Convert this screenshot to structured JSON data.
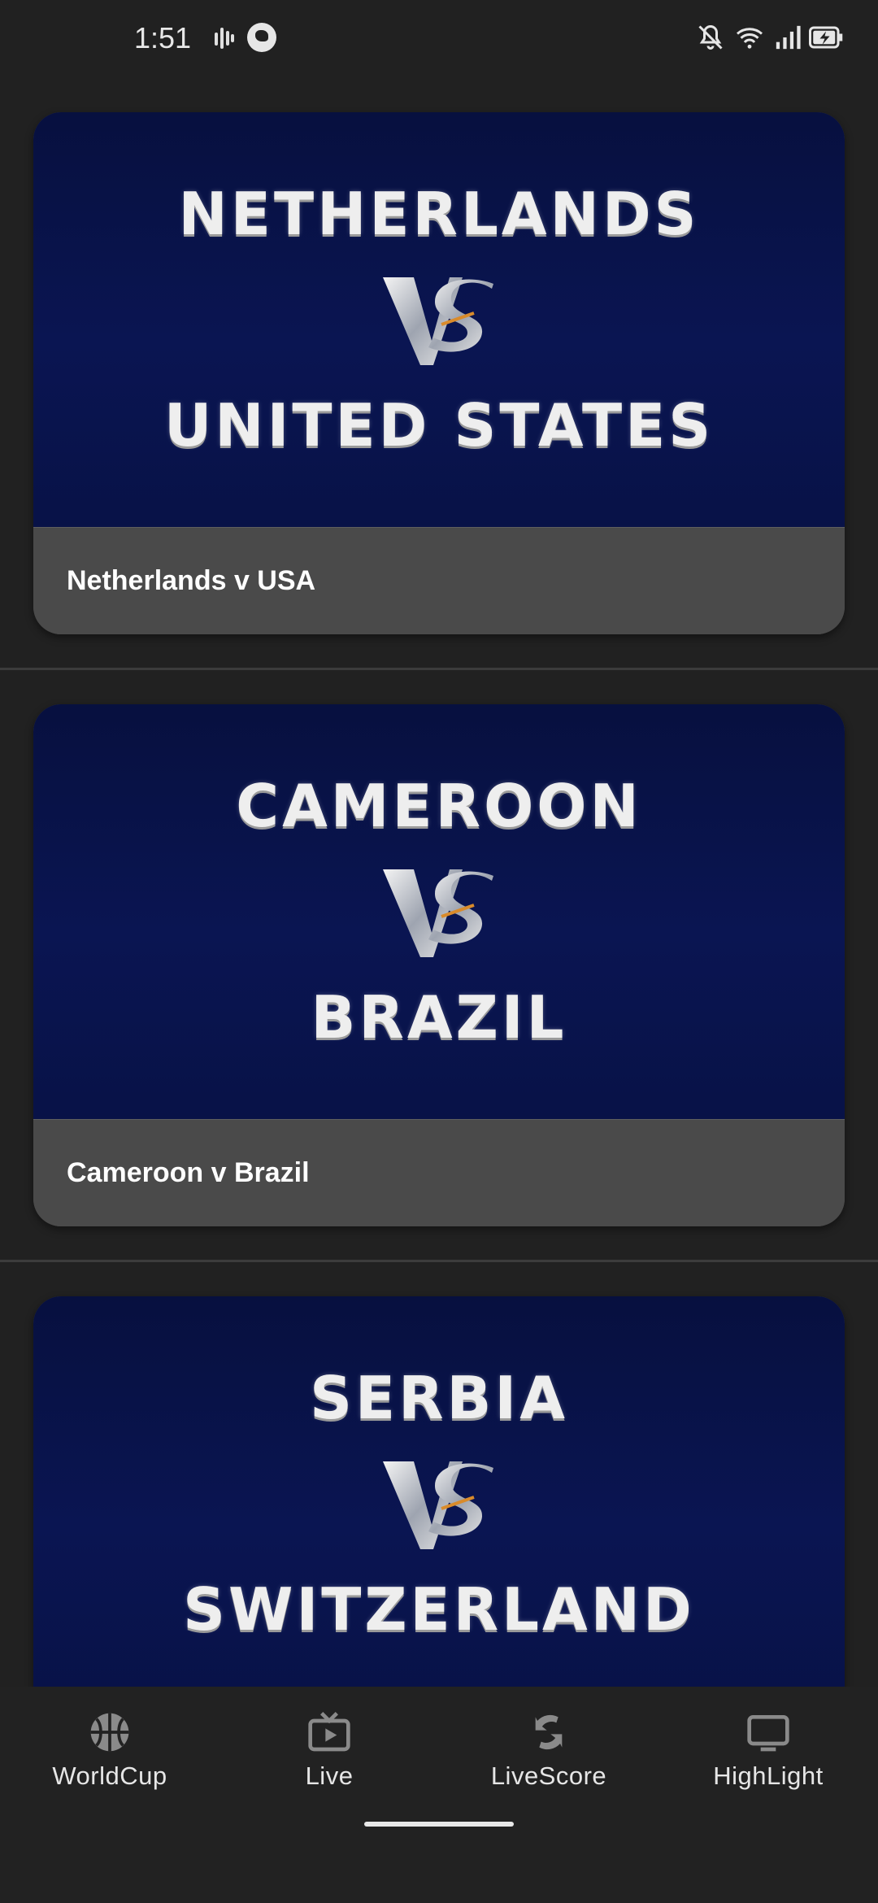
{
  "status_bar": {
    "time": "1:51",
    "icons": [
      "sound-bars-icon",
      "app-notification-icon",
      "mute-icon",
      "wifi-icon",
      "signal-icon",
      "battery-charging-icon"
    ]
  },
  "matches": [
    {
      "title": "Netherlands v USA",
      "thumbnail": {
        "team1": "NETHERLANDS",
        "vs": "VS",
        "team2": "UNITED STATES"
      }
    },
    {
      "title": "Cameroon v Brazil",
      "thumbnail": {
        "team1": "CAMEROON",
        "vs": "VS",
        "team2": "BRAZIL"
      }
    },
    {
      "title": "",
      "thumbnail": {
        "team1": "SERBIA",
        "vs": "VS",
        "team2": "SWITZERLAND"
      }
    }
  ],
  "bottom_nav": {
    "items": [
      {
        "label": "WorldCup",
        "icon": "basketball-icon"
      },
      {
        "label": "Live",
        "icon": "tv-play-icon"
      },
      {
        "label": "LiveScore",
        "icon": "refresh-icon"
      },
      {
        "label": "HighLight",
        "icon": "monitor-icon"
      }
    ]
  },
  "colors": {
    "background": "#212121",
    "card": "#4a4a4a",
    "thumbnail_bg": "#0a1552",
    "nav_icon": "#8a8a8a",
    "text": "#ffffff"
  }
}
